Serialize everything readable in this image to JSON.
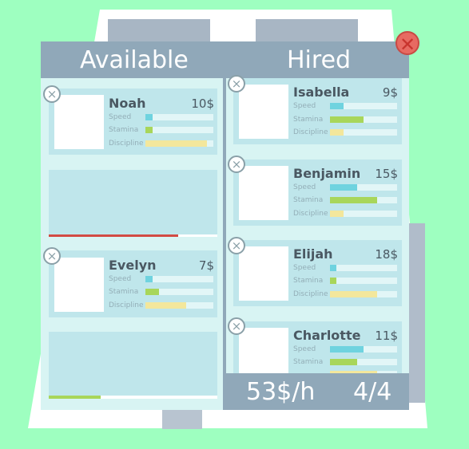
{
  "headers": {
    "available": "Available",
    "hired": "Hired"
  },
  "stat_labels": {
    "speed": "Speed",
    "stamina": "Stamina",
    "discipline": "Discipline"
  },
  "available": [
    {
      "name": "Noah",
      "price": "10$",
      "speed": 0.1,
      "stamina": 0.1,
      "discipline": 0.9
    },
    {
      "name": "",
      "price": "",
      "loading_progress": 0.77,
      "progress_color": "#d24b43"
    },
    {
      "name": "Evelyn",
      "price": "7$",
      "speed": 0.1,
      "stamina": 0.2,
      "discipline": 0.6
    },
    {
      "name": "",
      "price": "",
      "loading_progress": 0.31,
      "progress_color": "#a8d65a"
    }
  ],
  "hired": [
    {
      "name": "Isabella",
      "price": "9$",
      "speed": 0.2,
      "stamina": 0.5,
      "discipline": 0.2
    },
    {
      "name": "Benjamin",
      "price": "15$",
      "speed": 0.4,
      "stamina": 0.7,
      "discipline": 0.2
    },
    {
      "name": "Elijah",
      "price": "18$",
      "speed": 0.1,
      "stamina": 0.1,
      "discipline": 0.7
    },
    {
      "name": "Charlotte",
      "price": "11$",
      "speed": 0.5,
      "stamina": 0.4,
      "discipline": 0.7
    }
  ],
  "footer": {
    "income": "53$/h",
    "count": "4/4"
  },
  "icons": {
    "remove": "close-circle-icon",
    "close": "close-x-icon"
  },
  "colors": {
    "speed": "#6fd3df",
    "stamina": "#a8d65a",
    "discipline": "#f3e79c"
  }
}
